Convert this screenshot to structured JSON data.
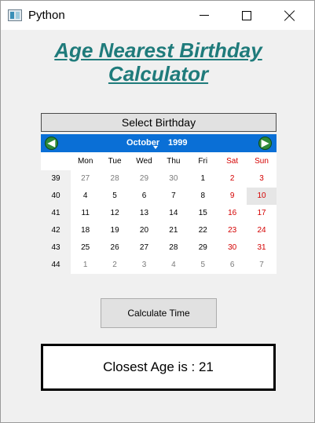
{
  "window": {
    "title": "Python"
  },
  "heading": {
    "line1": "Age Nearest Birthday",
    "line2": "Calculator"
  },
  "calendar": {
    "label": "Select Birthday",
    "month": "October",
    "year": "1999",
    "weekdays": [
      "Mon",
      "Tue",
      "Wed",
      "Thu",
      "Fri",
      "Sat",
      "Sun"
    ],
    "weeks": [
      {
        "week": "39",
        "days": [
          "27",
          "28",
          "29",
          "30",
          "1",
          "2",
          "3"
        ]
      },
      {
        "week": "40",
        "days": [
          "4",
          "5",
          "6",
          "7",
          "8",
          "9",
          "10"
        ]
      },
      {
        "week": "41",
        "days": [
          "11",
          "12",
          "13",
          "14",
          "15",
          "16",
          "17"
        ]
      },
      {
        "week": "42",
        "days": [
          "18",
          "19",
          "20",
          "21",
          "22",
          "23",
          "24"
        ]
      },
      {
        "week": "43",
        "days": [
          "25",
          "26",
          "27",
          "28",
          "29",
          "30",
          "31"
        ]
      },
      {
        "week": "44",
        "days": [
          "1",
          "2",
          "3",
          "4",
          "5",
          "6",
          "7"
        ]
      }
    ],
    "selected_day": "10"
  },
  "calculate_button": {
    "label": "Calculate Time"
  },
  "result": {
    "text": "Closest Age is : 21"
  },
  "colors": {
    "heading": "#1f7b7b",
    "nav_bar": "#0a6fd6",
    "weekend": "#d40000"
  }
}
